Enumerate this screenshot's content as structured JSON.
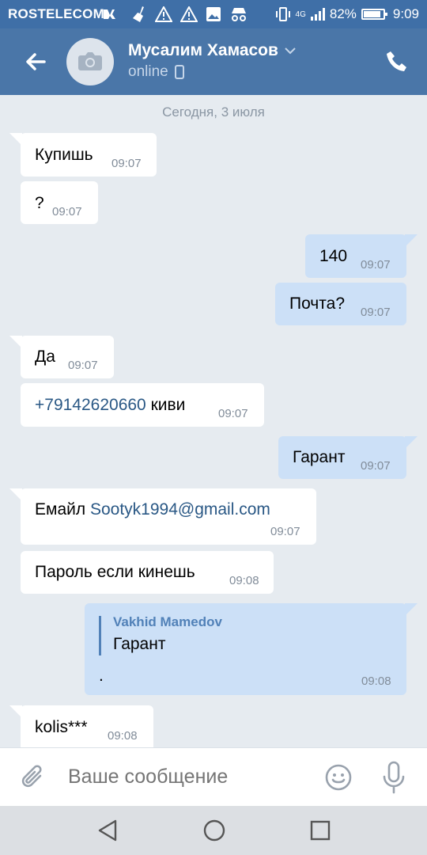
{
  "statusbar": {
    "carrier": "ROSTELECOM",
    "network": "4G",
    "battery": "82%",
    "time": "9:09"
  },
  "header": {
    "contact_name": "Мусалим Хамасов",
    "status": "online"
  },
  "chat": {
    "date_separator": "Сегодня, 3 июля",
    "messages": [
      {
        "dir": "in",
        "text": "Купишь",
        "time": "09:07"
      },
      {
        "dir": "in",
        "text": "?",
        "time": "09:07"
      },
      {
        "dir": "out",
        "text": "140",
        "time": "09:07"
      },
      {
        "dir": "out",
        "text": "Почта?",
        "time": "09:07"
      },
      {
        "dir": "in",
        "text": "Да",
        "time": "09:07"
      },
      {
        "dir": "in",
        "link": "+79142620660",
        "text": " киви",
        "time": "09:07"
      },
      {
        "dir": "out",
        "text": "Гарант",
        "time": "09:07"
      },
      {
        "dir": "in",
        "text": "Емайл ",
        "link": "Sootyk1994@gmail.com",
        "time": "09:07"
      },
      {
        "dir": "in",
        "text": "Пароль если кинешь",
        "time": "09:08"
      },
      {
        "dir": "out",
        "quote_author": "Vakhid Mamedov",
        "quote_text": "Гарант",
        "text": ".",
        "time": "09:08"
      },
      {
        "dir": "in",
        "text": "kolis***",
        "time": "09:08"
      }
    ]
  },
  "composer": {
    "placeholder": "Ваше сообщение"
  },
  "icons": {
    "back": "arrow-left-icon",
    "camera": "camera-icon",
    "call": "phone-icon",
    "attach": "paperclip-icon",
    "emoji": "smile-icon",
    "mic": "microphone-icon"
  },
  "colors": {
    "header_bg": "#4a76a8",
    "statusbar_bg": "#3f6fa7",
    "chat_bg": "#e6ebf0",
    "incoming_bubble": "#ffffff",
    "outgoing_bubble": "#cce0f7",
    "link": "#2a5885",
    "quote_accent": "#5181b8"
  }
}
